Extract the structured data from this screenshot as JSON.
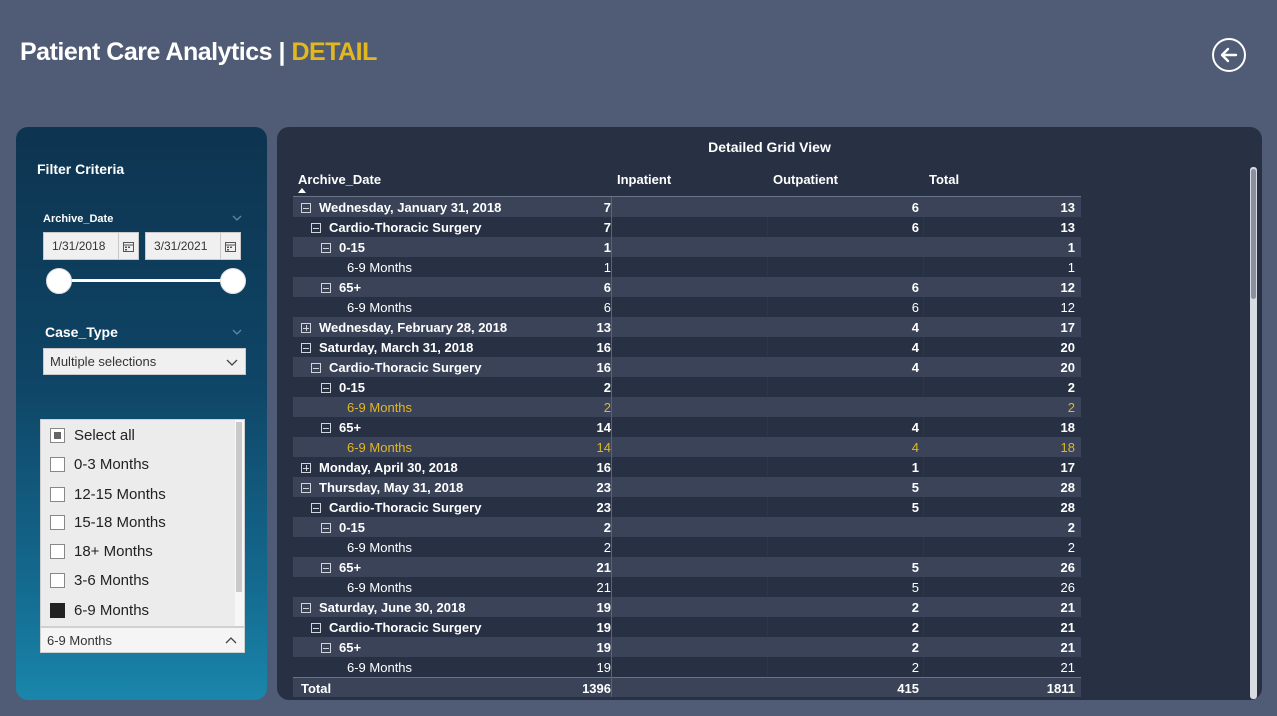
{
  "header": {
    "title": "Patient Care Analytics",
    "separator": "|",
    "subtitle": "DETAIL"
  },
  "filter": {
    "title": "Filter Criteria",
    "date_label": "Archive_Date",
    "date_from": "1/31/2018",
    "date_to": "3/31/2021",
    "case_type_label": "Case_Type",
    "case_type_value": "Multiple selections",
    "options": [
      {
        "label": "Select all",
        "state": "partial"
      },
      {
        "label": "0-3 Months",
        "state": "unchecked"
      },
      {
        "label": "12-15 Months",
        "state": "unchecked"
      },
      {
        "label": "15-18 Months",
        "state": "unchecked"
      },
      {
        "label": "18+ Months",
        "state": "unchecked"
      },
      {
        "label": "3-6 Months",
        "state": "unchecked"
      },
      {
        "label": "6-9 Months",
        "state": "checked"
      }
    ],
    "footer_value": "6-9 Months"
  },
  "grid": {
    "title": "Detailed Grid View",
    "columns": [
      "Archive_Date",
      "Inpatient",
      "Outpatient",
      "Total"
    ],
    "rows": [
      {
        "level": 0,
        "icon": "minus",
        "label": "Wednesday, January 31, 2018",
        "inpatient": "7",
        "outpatient": "6",
        "total": "13",
        "bold": true
      },
      {
        "level": 1,
        "icon": "minus",
        "label": "Cardio-Thoracic Surgery",
        "inpatient": "7",
        "outpatient": "6",
        "total": "13",
        "bold": true
      },
      {
        "level": 2,
        "icon": "minus",
        "label": "0-15",
        "inpatient": "1",
        "outpatient": "",
        "total": "1",
        "bold": true
      },
      {
        "level": 3,
        "icon": "",
        "label": "6-9 Months",
        "inpatient": "1",
        "outpatient": "",
        "total": "1",
        "bold": false
      },
      {
        "level": 2,
        "icon": "minus",
        "label": "65+",
        "inpatient": "6",
        "outpatient": "6",
        "total": "12",
        "bold": true
      },
      {
        "level": 3,
        "icon": "",
        "label": "6-9 Months",
        "inpatient": "6",
        "outpatient": "6",
        "total": "12",
        "bold": false
      },
      {
        "level": 0,
        "icon": "plus",
        "label": "Wednesday, February 28, 2018",
        "inpatient": "13",
        "outpatient": "4",
        "total": "17",
        "bold": true
      },
      {
        "level": 0,
        "icon": "minus",
        "label": "Saturday, March 31, 2018",
        "inpatient": "16",
        "outpatient": "4",
        "total": "20",
        "bold": true
      },
      {
        "level": 1,
        "icon": "minus",
        "label": "Cardio-Thoracic Surgery",
        "inpatient": "16",
        "outpatient": "4",
        "total": "20",
        "bold": true
      },
      {
        "level": 2,
        "icon": "minus",
        "label": "0-15",
        "inpatient": "2",
        "outpatient": "",
        "total": "2",
        "bold": true
      },
      {
        "level": 3,
        "icon": "",
        "label": "6-9 Months",
        "inpatient": "2",
        "outpatient": "",
        "total": "2",
        "bold": false,
        "highlight": true
      },
      {
        "level": 2,
        "icon": "minus",
        "label": "65+",
        "inpatient": "14",
        "outpatient": "4",
        "total": "18",
        "bold": true
      },
      {
        "level": 3,
        "icon": "",
        "label": "6-9 Months",
        "inpatient": "14",
        "outpatient": "4",
        "total": "18",
        "bold": false,
        "highlight": true
      },
      {
        "level": 0,
        "icon": "plus",
        "label": "Monday, April 30, 2018",
        "inpatient": "16",
        "outpatient": "1",
        "total": "17",
        "bold": true
      },
      {
        "level": 0,
        "icon": "minus",
        "label": "Thursday, May 31, 2018",
        "inpatient": "23",
        "outpatient": "5",
        "total": "28",
        "bold": true
      },
      {
        "level": 1,
        "icon": "minus",
        "label": "Cardio-Thoracic Surgery",
        "inpatient": "23",
        "outpatient": "5",
        "total": "28",
        "bold": true
      },
      {
        "level": 2,
        "icon": "minus",
        "label": "0-15",
        "inpatient": "2",
        "outpatient": "",
        "total": "2",
        "bold": true
      },
      {
        "level": 3,
        "icon": "",
        "label": "6-9 Months",
        "inpatient": "2",
        "outpatient": "",
        "total": "2",
        "bold": false
      },
      {
        "level": 2,
        "icon": "minus",
        "label": "65+",
        "inpatient": "21",
        "outpatient": "5",
        "total": "26",
        "bold": true
      },
      {
        "level": 3,
        "icon": "",
        "label": "6-9 Months",
        "inpatient": "21",
        "outpatient": "5",
        "total": "26",
        "bold": false
      },
      {
        "level": 0,
        "icon": "minus",
        "label": "Saturday, June 30, 2018",
        "inpatient": "19",
        "outpatient": "2",
        "total": "21",
        "bold": true
      },
      {
        "level": 1,
        "icon": "minus",
        "label": "Cardio-Thoracic Surgery",
        "inpatient": "19",
        "outpatient": "2",
        "total": "21",
        "bold": true
      },
      {
        "level": 2,
        "icon": "minus",
        "label": "65+",
        "inpatient": "19",
        "outpatient": "2",
        "total": "21",
        "bold": true
      },
      {
        "level": 3,
        "icon": "",
        "label": "6-9 Months",
        "inpatient": "19",
        "outpatient": "2",
        "total": "21",
        "bold": false
      }
    ],
    "total": {
      "label": "Total",
      "inpatient": "1396",
      "outpatient": "415",
      "total": "1811"
    }
  }
}
